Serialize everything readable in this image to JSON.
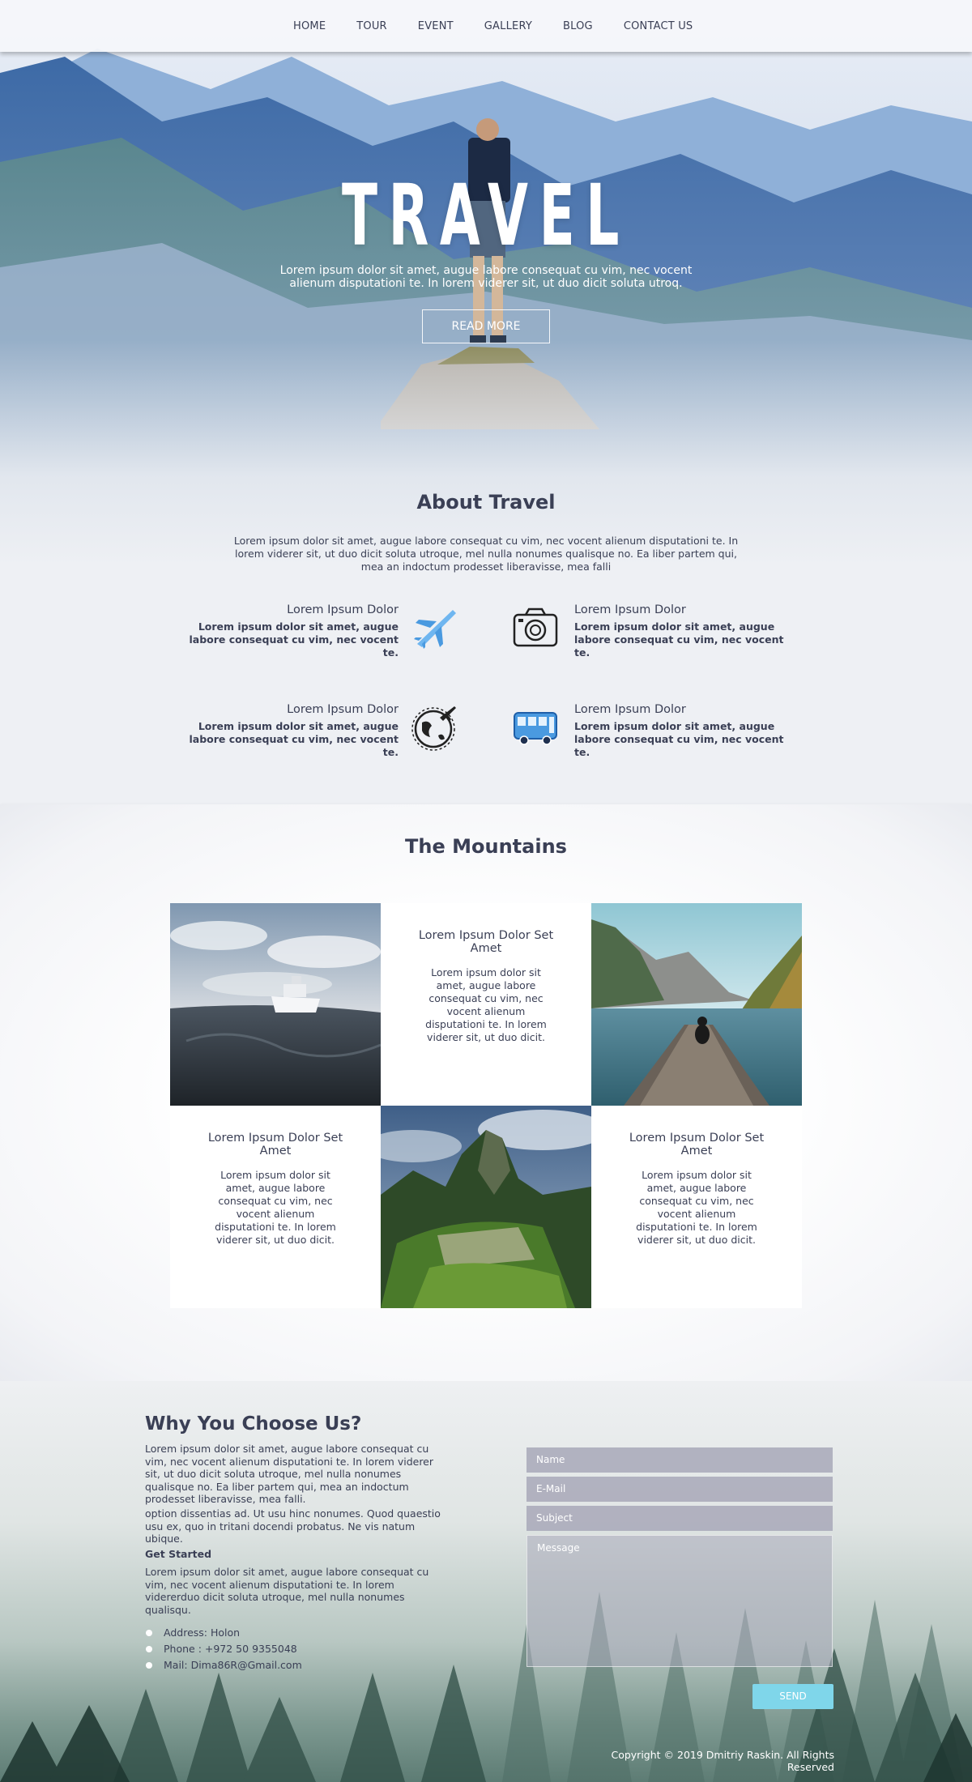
{
  "nav": {
    "items": [
      "HOME",
      "TOUR",
      "EVENT",
      "GALLERY",
      "BLOG",
      "CONTACT US"
    ]
  },
  "hero": {
    "title": "TRAVEL",
    "text": "Lorem ipsum dolor sit amet, augue labore consequat cu vim, nec vocent alienum disputationi te. In lorem viderer sit, ut duo dicit soluta utroq.",
    "button": "READ MORE"
  },
  "about": {
    "title": "About Travel",
    "text": "Lorem ipsum dolor sit amet, augue labore consequat cu vim, nec vocent alienum disputationi te. In lorem viderer sit, ut duo dicit soluta utroque, mel nulla nonumes qualisque no. Ea liber partem qui, mea an indoctum prodesset liberavisse, mea falli",
    "features": [
      {
        "title": "Lorem Ipsum Dolor",
        "text": "Lorem ipsum dolor sit amet, augue labore consequat cu vim, nec vocent te.",
        "icon": "airplane-icon"
      },
      {
        "title": "Lorem Ipsum Dolor",
        "text": "Lorem ipsum dolor sit amet, augue labore consequat cu vim, nec vocent te.",
        "icon": "camera-icon"
      },
      {
        "title": "Lorem Ipsum Dolor",
        "text": "Lorem ipsum dolor sit amet, augue labore consequat cu vim, nec vocent te.",
        "icon": "globe-plane-icon"
      },
      {
        "title": "Lorem Ipsum Dolor",
        "text": "Lorem ipsum dolor sit amet, augue labore consequat cu vim, nec vocent te.",
        "icon": "bus-icon"
      }
    ]
  },
  "mountains": {
    "title": "The Mountains",
    "cards": [
      {
        "title": "Lorem Ipsum Dolor Set Amet",
        "text": "Lorem ipsum dolor sit amet, augue labore consequat cu vim, nec vocent alienum disputationi te. In lorem viderer sit, ut duo dicit."
      },
      {
        "title": "Lorem Ipsum Dolor Set Amet",
        "text": "Lorem ipsum dolor sit amet, augue labore consequat cu vim, nec vocent alienum disputationi te. In lorem viderer sit, ut duo dicit."
      },
      {
        "title": "Lorem Ipsum Dolor Set Amet",
        "text": "Lorem ipsum dolor sit amet, augue labore consequat cu vim, nec vocent alienum disputationi te. In lorem viderer sit, ut duo dicit."
      }
    ]
  },
  "why": {
    "title": "Why You Choose Us?",
    "text": "Lorem ipsum dolor sit amet, augue labore consequat cu vim, nec vocent alienum disputationi te. In lorem viderer sit, ut duo dicit soluta utroque, mel nulla nonumes qualisque no. Ea liber partem qui, mea an indoctum prodesset liberavisse, mea falli.",
    "text2": "option dissentias ad. Ut usu hinc nonumes. Quod quaestio usu ex, quo in tritani docendi probatus. Ne vis natum ubique.",
    "get_started_title": "Get Started",
    "get_started_text": "Lorem ipsum dolor sit amet, augue labore consequat cu vim, nec vocent alienum disputationi te. In lorem vidererduo dicit soluta utroque, mel nulla nonumes qualisqu.",
    "contacts": [
      "Address: Holon",
      "Phone : +972 50 9355048",
      "Mail: Dima86R@Gmail.com"
    ]
  },
  "form": {
    "name_placeholder": "Name",
    "email_placeholder": "E-Mail",
    "subject_placeholder": "Subject",
    "message_placeholder": "Message",
    "send_label": "SEND"
  },
  "footer": {
    "copyright": "Copyright © 2019 Dmitriy Raskin. All Rights Reserved"
  },
  "colors": {
    "text": "#3a3f55",
    "accent_button": "#7fd6ea",
    "field_bg": "#aaaab9",
    "icon_blue": "#4a9ae0"
  }
}
